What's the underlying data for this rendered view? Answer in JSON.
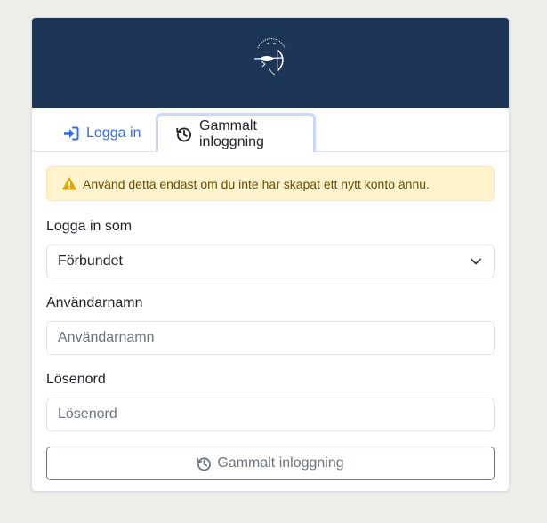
{
  "tabs": {
    "login_label": "Logga in",
    "legacy_label": "Gammalt inloggning"
  },
  "alert": {
    "icon": "warning-icon",
    "text": "Använd detta endast om du inte har skapat ett nytt konto ännu."
  },
  "form": {
    "login_as_label": "Logga in som",
    "login_as_value": "Förbundet",
    "username_label": "Användarnamn",
    "username_placeholder": "Användarnamn",
    "username_value": "",
    "password_label": "Lösenord",
    "password_placeholder": "Lösenord",
    "password_value": "",
    "submit_label": "Gammalt inloggning"
  },
  "colors": {
    "banner": "#1d3557",
    "accent": "#2f6fed",
    "alert_bg": "#fff3cd",
    "page_bg": "#eeede9"
  }
}
